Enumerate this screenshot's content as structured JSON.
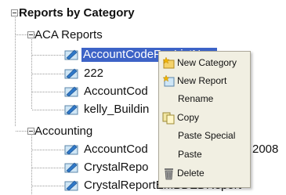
{
  "tree": {
    "root_label": "Reports by Category",
    "aca_label": "ACA Reports",
    "aca_items": [
      "AccountCodeFeeListNew",
      "222",
      "AccountCod",
      "kelly_Buildin"
    ],
    "accounting_label": "Accounting",
    "accounting_items": [
      "AccountCod",
      "2008",
      "CrystalRepo",
      "CrystalReportEMBDEDReport"
    ]
  },
  "context_menu": {
    "items": [
      "New Category",
      "New Report",
      "Rename",
      "Copy",
      "Paste Special",
      "Paste",
      "Delete"
    ]
  },
  "colors": {
    "selection": "#3d63c7",
    "menu_bg": "#f1efe2",
    "tree_line": "#9a9a9a"
  }
}
